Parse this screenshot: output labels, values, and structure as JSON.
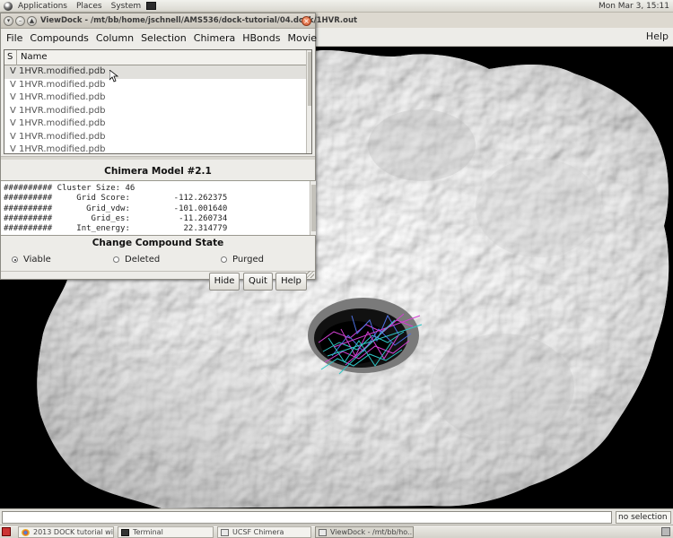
{
  "topbar": {
    "menus": [
      "Applications",
      "Places",
      "System"
    ],
    "clock": "Mon Mar 3, 15:11"
  },
  "chimera": {
    "help_label": "Help",
    "status": {
      "selection": "no selection"
    }
  },
  "viewdock": {
    "title": "ViewDock - /mt/bb/home/jschnell/AMS536/dock-tutorial/04.dock/1HVR.out",
    "menu": {
      "file": "File",
      "compounds": "Compounds",
      "column": "Column",
      "selection": "Selection",
      "chimera": "Chimera",
      "hbonds": "HBonds",
      "movie": "Movie"
    },
    "columns": {
      "s": "S",
      "name": "Name"
    },
    "rows": [
      {
        "s": "V",
        "name": "1HVR.modified.pdb"
      },
      {
        "s": "V",
        "name": "1HVR.modified.pdb"
      },
      {
        "s": "V",
        "name": "1HVR.modified.pdb"
      },
      {
        "s": "V",
        "name": "1HVR.modified.pdb"
      },
      {
        "s": "V",
        "name": "1HVR.modified.pdb"
      },
      {
        "s": "V",
        "name": "1HVR.modified.pdb"
      },
      {
        "s": "V",
        "name": "1HVR.modified.pdb"
      }
    ],
    "model_title": "Chimera Model #2.1",
    "info_lines": [
      "########## Cluster Size: 46",
      "##########     Grid Score:         -112.262375",
      "##########       Grid_vdw:         -101.001640",
      "##########        Grid_es:          -11.260734",
      "##########     Int_energy:           22.314779"
    ],
    "state_title": "Change Compound State",
    "states": {
      "viable": "Viable",
      "deleted": "Deleted",
      "purged": "Purged",
      "selected": "viable"
    },
    "buttons": {
      "hide": "Hide",
      "quit": "Quit",
      "help": "Help"
    }
  },
  "taskbar": {
    "items": [
      {
        "label": "2013 DOCK tutorial wi...",
        "icon": "chrome-icon"
      },
      {
        "label": "Terminal",
        "icon": "terminal-icon"
      },
      {
        "label": "UCSF Chimera",
        "icon": "window-icon"
      },
      {
        "label": "ViewDock - /mt/bb/ho...",
        "icon": "window-icon"
      }
    ]
  },
  "colors": {
    "surface": "#e8e8e8",
    "ligand_magenta": "#d23fd2",
    "ligand_cyan": "#2fc7c7",
    "ligand_blue": "#4d6fe0"
  }
}
